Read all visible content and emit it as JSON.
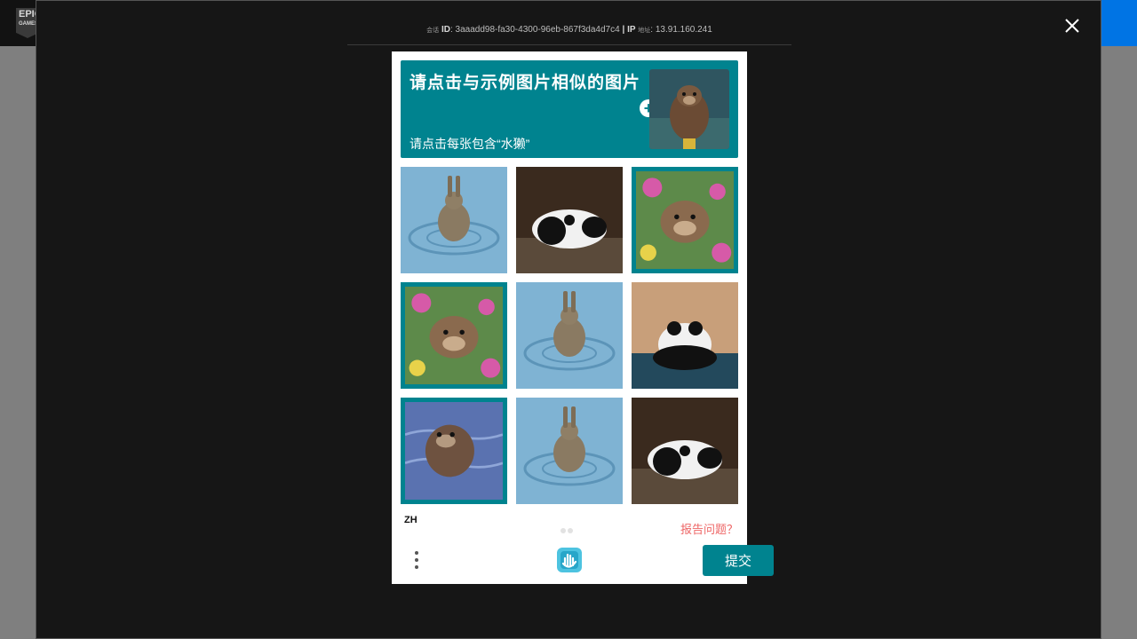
{
  "header": {
    "logo_text": "EPIC",
    "logo_sub": "GAMES"
  },
  "session": {
    "id_prefix": "会话",
    "id_label": "ID",
    "id_value": "3aaadd98-fa30-4300-96eb-867f3da4d7c4",
    "separator": "|",
    "ip_label": "IP",
    "ip_prefix": "地址",
    "ip_value": "13.91.160.241"
  },
  "captcha": {
    "prompt_title": "请点击与示例图片相似的图片",
    "prompt_subtitle": "请点击每张包含“水獭”",
    "plus_symbol": "+",
    "tiles": [
      {
        "subject": "rabbit-in-water",
        "selected": false
      },
      {
        "subject": "panda-on-sofa",
        "selected": false
      },
      {
        "subject": "otter-in-flowers",
        "selected": true
      },
      {
        "subject": "otter-in-flowers",
        "selected": true
      },
      {
        "subject": "rabbit-in-water",
        "selected": false
      },
      {
        "subject": "panda-in-water",
        "selected": false
      },
      {
        "subject": "otter-in-water",
        "selected": true
      },
      {
        "subject": "rabbit-in-water",
        "selected": false
      },
      {
        "subject": "panda-on-sofa",
        "selected": false
      }
    ],
    "language": "ZH",
    "report_label": "报告问题？",
    "submit_label": "提交"
  },
  "colors": {
    "accent": "#00838f",
    "modal_bg": "#161616",
    "error": "#e66666",
    "brand_blue": "#0074e4"
  }
}
